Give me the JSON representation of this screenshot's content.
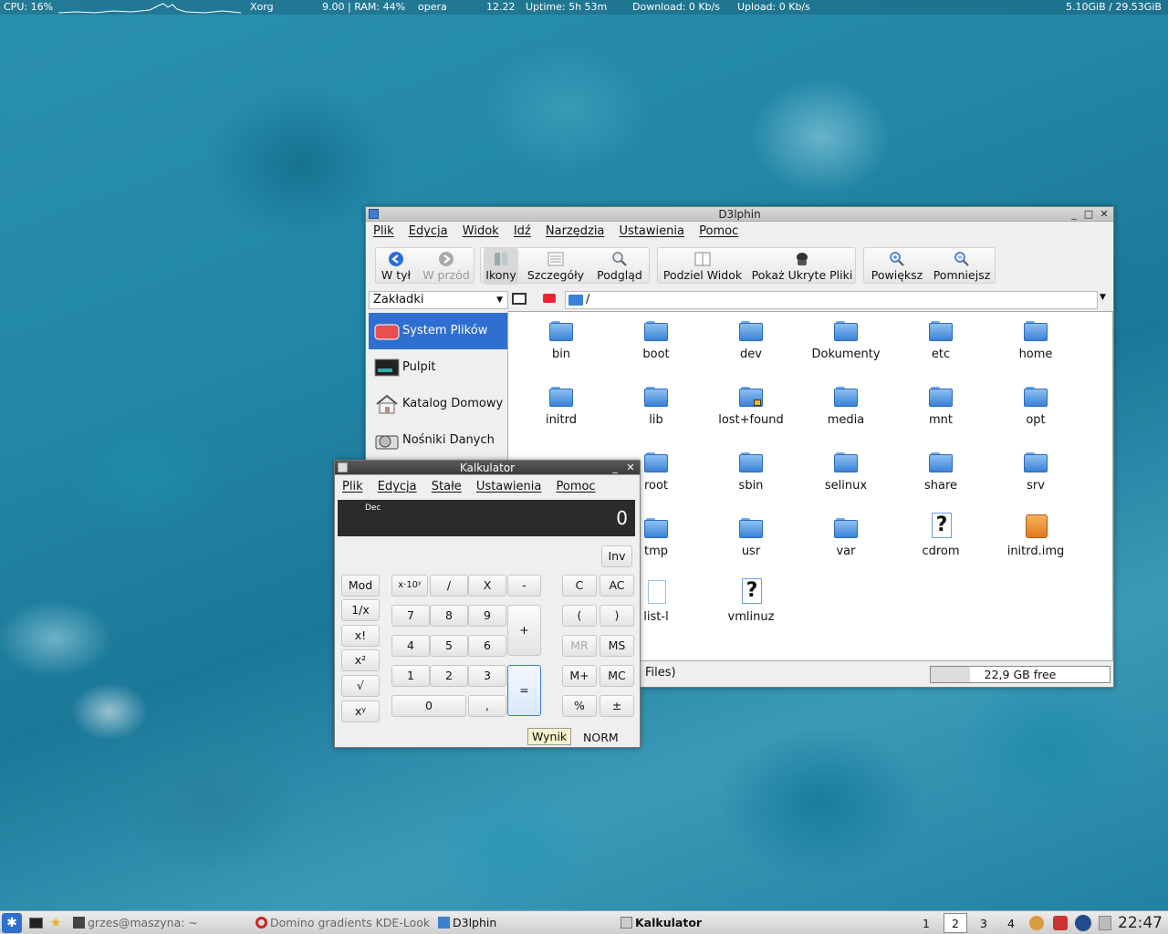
{
  "topbar": {
    "cpu": "CPU: 16%",
    "proc1": "Xorg",
    "stats": "9.00 | RAM: 44%",
    "proc2": "opera",
    "time": "12.22",
    "uptime": "Uptime: 5h 53m",
    "download": "Download: 0 Kb/s",
    "upload": "Upload: 0 Kb/s",
    "disk": "5.10GiB / 29.53GiB"
  },
  "dolphin": {
    "title": "D3lphin",
    "menu": [
      "Plik",
      "Edycja",
      "Widok",
      "Idź",
      "Narzędzia",
      "Ustawienia",
      "Pomoc"
    ],
    "toolbar": {
      "back": "W tył",
      "forward": "W przód",
      "icons": "Ikony",
      "details": "Szczegóły",
      "preview": "Podgląd",
      "split": "Podziel Widok",
      "hidden": "Pokaż Ukryte Pliki",
      "zoom_in": "Powiększ",
      "zoom_out": "Pomniejsz"
    },
    "bookmarks_label": "Zakładki",
    "places": [
      "System Plików",
      "Pulpit",
      "Katalog Domowy",
      "Nośniki Danych"
    ],
    "path": "/",
    "files": [
      "bin",
      "boot",
      "dev",
      "Dokumenty",
      "etc",
      "home",
      "initrd",
      "lib",
      "lost+found",
      "media",
      "mnt",
      "opt",
      "root",
      "sbin",
      "selinux",
      "share",
      "srv",
      "tmp",
      "usr",
      "var",
      "cdrom",
      "initrd.img",
      "list-l",
      "vmlinuz"
    ],
    "status_left": "Files)",
    "free": "22,9 GB free",
    "free_used_fraction": 0.22
  },
  "calc": {
    "title": "Kalkulator",
    "menu": [
      "Plik",
      "Edycja",
      "Stałe",
      "Ustawienia",
      "Pomoc"
    ],
    "base": "Dec",
    "display": "0",
    "inv": "Inv",
    "buttons": {
      "mod": "Mod",
      "recip": "1/x",
      "fact": "x!",
      "sq": "x²",
      "sqrt": "√",
      "pow": "xʸ",
      "exp": "x·10ʸ",
      "div": "/",
      "mul": "X",
      "sub": "-",
      "add": "+",
      "eq": "=",
      "dot": ",",
      "d7": "7",
      "d8": "8",
      "d9": "9",
      "d4": "4",
      "d5": "5",
      "d6": "6",
      "d1": "1",
      "d2": "2",
      "d3": "3",
      "d0": "0",
      "c": "C",
      "ac": "AC",
      "lpar": "(",
      "rpar": ")",
      "mr": "MR",
      "ms": "MS",
      "mplus": "M+",
      "mc": "MC",
      "pct": "%",
      "pm": "±"
    },
    "tooltip": "Wynik",
    "mode": "NORM"
  },
  "taskbar": {
    "tasks": [
      "grzes@maszyna: ~",
      "Domino gradients KDE-Look",
      "D3lphin",
      "Kalkulator"
    ],
    "desktops": [
      "1",
      "2",
      "3",
      "4"
    ],
    "clock": "22:47"
  },
  "colors": {
    "selection": "#2f6fd0",
    "folder": "#3a82d8",
    "display_bg": "#2b2b2b",
    "accent_eq": "#3a7bd5"
  }
}
